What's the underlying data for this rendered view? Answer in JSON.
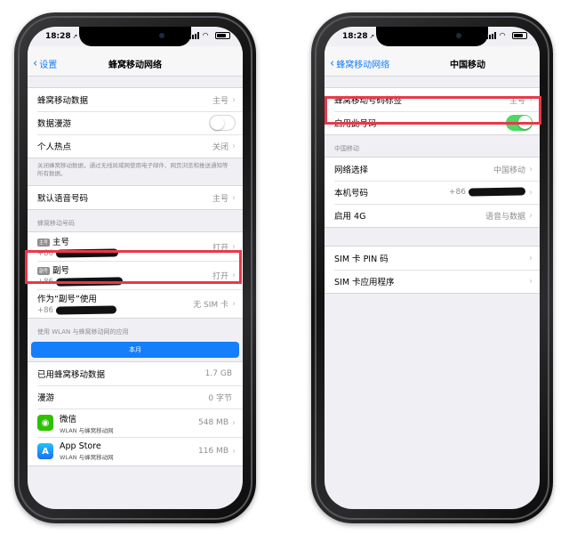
{
  "status": {
    "time": "18:28"
  },
  "left": {
    "nav": {
      "back_label": "设置",
      "title": "蜂窝移动网络"
    },
    "group1": [
      {
        "label": "蜂窝移动数据",
        "value": "主号"
      },
      {
        "label": "数据漫游",
        "toggle": "off"
      },
      {
        "label": "个人热点",
        "value": "关闭"
      }
    ],
    "footnote": "关闭蜂窝移动数据，通过无线局域网使用电子邮件、网页浏览和推送通知等所有数据。",
    "voice_row": {
      "label": "默认语音号码",
      "value": "主号"
    },
    "lines_header": "蜂窝移动号码",
    "lines": [
      {
        "tag": "主号",
        "name": "主号",
        "number": "+86",
        "value": "打开"
      },
      {
        "tag": "副号",
        "name": "副号",
        "number": "+86",
        "value": "打开"
      },
      {
        "tag": "",
        "name": "作为“副号”使用",
        "number": "+86",
        "value": "无 SIM 卡"
      }
    ],
    "apps_header": "使用 WLAN 与蜂窝移动网的应用",
    "segment_label": "本月",
    "usage": [
      {
        "label": "已用蜂窝移动数据",
        "value": "1.7 GB"
      },
      {
        "label": "漫游",
        "value": "0 字节"
      }
    ],
    "apps": [
      {
        "name": "微信",
        "sub": "WLAN 与蜂窝移动网",
        "value": "548 MB",
        "icon": "wechat-icon"
      },
      {
        "name": "App Store",
        "sub": "WLAN 与蜂窝移动网",
        "value": "116 MB",
        "icon": "app-store-icon"
      }
    ]
  },
  "right": {
    "nav": {
      "back_label": "蜂窝移动网络",
      "title": "中国移动"
    },
    "group1": [
      {
        "label": "蜂窝移动号码标签",
        "value": "主号"
      },
      {
        "label": "启用此号码",
        "toggle": "on"
      }
    ],
    "carrier_header": "中国移动",
    "group2": [
      {
        "label": "网络选择",
        "value": "中国移动"
      },
      {
        "label": "本机号码",
        "value": "+86"
      },
      {
        "label": "启用 4G",
        "value": "语音与数据"
      }
    ],
    "group3": [
      {
        "label": "SIM 卡 PIN 码"
      },
      {
        "label": "SIM 卡应用程序"
      }
    ]
  },
  "colors": {
    "accent": "#147efb",
    "toggle_on": "#4cd964",
    "highlight": "#e8394a"
  }
}
